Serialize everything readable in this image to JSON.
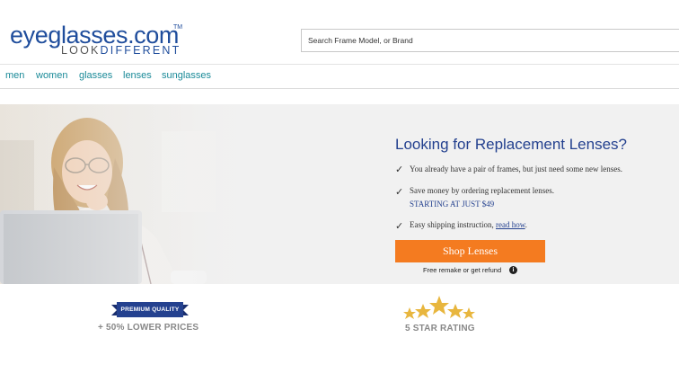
{
  "header": {
    "logo_main": "eyeglasses.com",
    "logo_tm": "TM",
    "logo_tag_left": "LOOK",
    "logo_tag_right": "DIFFERENT",
    "search_placeholder": "Search Frame Model, or Brand"
  },
  "nav": {
    "items": [
      {
        "label": "men"
      },
      {
        "label": "women"
      },
      {
        "label": "glasses"
      },
      {
        "label": "lenses"
      },
      {
        "label": "sunglasses"
      }
    ]
  },
  "promo": {
    "title": "Looking for Replacement Lenses?",
    "bullets": [
      "You already have a pair of frames, but just need some new lenses.",
      "Save money by ordering replacement lenses."
    ],
    "starting_price": "STARTING AT JUST $49",
    "shipping_text": "Easy shipping instruction,",
    "read_how": "read how",
    "period": ".",
    "cta_label": "Shop Lenses",
    "refund_text": "Free remake or get refund",
    "info_glyph": "i"
  },
  "features": {
    "badge_label": "PREMIUM QUALITY",
    "lower_prices": "+ 50% LOWER PRICES",
    "rating_label": "5 STAR RATING"
  },
  "colors": {
    "brand_blue": "#1f4d9c",
    "nav_teal": "#1a8a98",
    "cta_orange": "#f47b20",
    "star_gold": "#e8b63e"
  }
}
